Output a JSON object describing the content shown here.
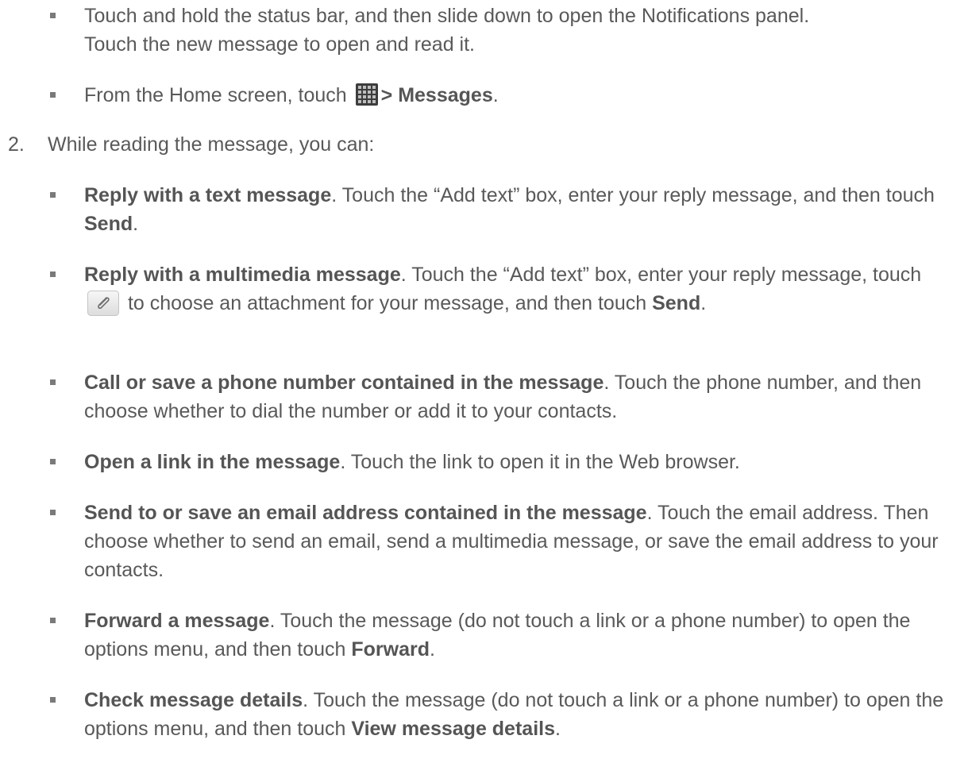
{
  "intro_bullets": {
    "b1_line1": "Touch and hold the status bar, and then slide down to open the Notifications panel.",
    "b1_line2": "Touch the new message to open and read it.",
    "b2_pre": "From the Home screen, touch",
    "b2_menu": "> Messages",
    "b2_end": "."
  },
  "step2": {
    "number": "2.",
    "text": "While reading the message, you can:"
  },
  "options": {
    "o1_bold": "Reply with a text message",
    "o1_text": ". Touch the “Add text” box, enter your reply message, and then touch ",
    "o1_bold2": "Send",
    "o1_end": ".",
    "o2_bold": "Reply with a multimedia message",
    "o2_text": ". Touch the “Add text” box, enter your reply message, touch",
    "o2_text2": "to choose an attachment for your message, and then touch ",
    "o2_bold2": "Send",
    "o2_end": ".",
    "o3_bold": "Call or save a phone number contained in the message",
    "o3_text": ". Touch the phone number, and then choose whether to dial the number or add it to your contacts.",
    "o4_bold": "Open a link in the message",
    "o4_text": ". Touch the link to open it in the Web browser.",
    "o5_bold": "Send to or save an email address contained in the message",
    "o5_text": ". Touch the email address. Then choose whether to send an email, send a multimedia message, or save the email address to your contacts.",
    "o6_bold": "Forward a message",
    "o6_text": ". Touch the message (do not touch a link or a phone number) to open the options menu, and then touch ",
    "o6_bold2": "Forward",
    "o6_end": ".",
    "o7_bold": "Check message details",
    "o7_text": ". Touch the message (do not touch a link or a phone number) to open the options menu, and then touch ",
    "o7_bold2": "View message details",
    "o7_end": "."
  },
  "icons": {
    "apps_icon": "apps-grid-icon",
    "attach_icon": "paperclip-icon"
  }
}
